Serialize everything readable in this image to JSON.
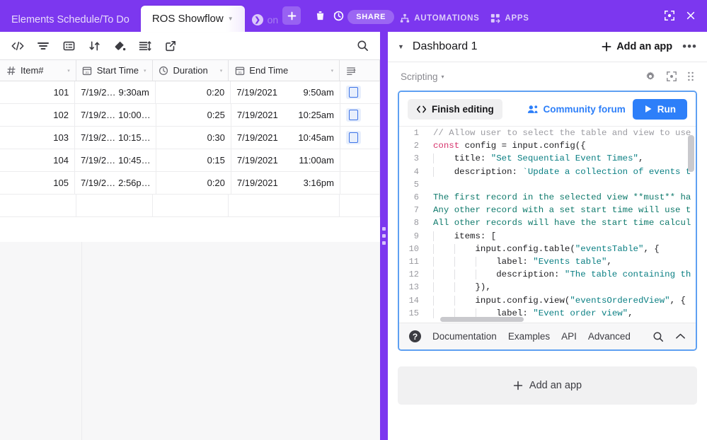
{
  "topbar": {
    "accent_color": "#7c37ef",
    "tabs": [
      {
        "label": "Elements Schedule/To Do",
        "active": false,
        "partial": false
      },
      {
        "label": "ROS Showflow",
        "active": true,
        "partial": false,
        "caret": "▼"
      },
      {
        "label": "on",
        "active": false,
        "partial": true,
        "icon": "chevron-right-circle-icon"
      }
    ],
    "add_tab_label": "+",
    "trash_icon": "trash-icon",
    "history_icon": "history-clock-icon",
    "share_label": "SHARE",
    "automations_label": "AUTOMATIONS",
    "apps_label": "APPS",
    "expand_icon": "expand-icon",
    "close_icon": "close-icon"
  },
  "grid_toolbar": {
    "icons": [
      {
        "name": "code-view-icon",
        "glyph": "</>"
      },
      {
        "name": "filter-icon",
        "glyph": "filter"
      },
      {
        "name": "group-icon",
        "glyph": "group"
      },
      {
        "name": "sort-icon",
        "glyph": "sort"
      },
      {
        "name": "color-fill-icon",
        "glyph": "paint"
      },
      {
        "name": "row-height-icon",
        "glyph": "rowheight"
      },
      {
        "name": "share-view-icon",
        "glyph": "external"
      }
    ],
    "search_icon": "search-icon"
  },
  "table": {
    "columns": [
      {
        "label": "Item#",
        "icon": "hash-icon",
        "caret": "▾"
      },
      {
        "label": "Start Time",
        "icon": "calendar-icon",
        "caret": "▾"
      },
      {
        "label": "Duration",
        "icon": "clock-icon",
        "caret": "▾"
      },
      {
        "label": "End Time",
        "icon": "calendar-icon",
        "caret": "▾"
      },
      {
        "label": "",
        "icon": "long-text-icon",
        "caret": ""
      }
    ],
    "rows": [
      {
        "item": "101",
        "start_date": "7/19/2…",
        "start_time": "9:30am",
        "duration": "0:20",
        "end_date": "7/19/2021",
        "end_time": "9:50am",
        "has_badge": true
      },
      {
        "item": "102",
        "start_date": "7/19/2…",
        "start_time": "10:00…",
        "duration": "0:25",
        "end_date": "7/19/2021",
        "end_time": "10:25am",
        "has_badge": true
      },
      {
        "item": "103",
        "start_date": "7/19/2…",
        "start_time": "10:15…",
        "duration": "0:30",
        "end_date": "7/19/2021",
        "end_time": "10:45am",
        "has_badge": true
      },
      {
        "item": "104",
        "start_date": "7/19/2…",
        "start_time": "10:45…",
        "duration": "0:15",
        "end_date": "7/19/2021",
        "end_time": "11:00am",
        "has_badge": false
      },
      {
        "item": "105",
        "start_date": "7/19/2…",
        "start_time": "2:56p…",
        "duration": "0:20",
        "end_date": "7/19/2021",
        "end_time": "3:16pm",
        "has_badge": false
      }
    ]
  },
  "divider": {
    "handle_icon": "drag-handle-icon"
  },
  "dashboard": {
    "caret": "▼",
    "title": "Dashboard 1",
    "add_app_label": "Add an app",
    "add_app_plus": "+",
    "more_dots": "•••",
    "app": {
      "name": "Scripting",
      "name_caret": "▾",
      "settings_icon": "gear-icon",
      "fullscreen_icon": "expand-app-icon",
      "drag_icon": "drag-dots-icon",
      "toolbar": {
        "finish_editing_label": "Finish editing",
        "code_icon": "code-brackets-icon",
        "community_forum_label": "Community forum",
        "people_icon": "people-icon",
        "run_label": "Run",
        "play_icon": "play-icon"
      },
      "code_lines": [
        {
          "n": "1",
          "tokens": [
            {
              "t": "com",
              "s": "// Allow user to select the table and view to use"
            }
          ],
          "indent": 0
        },
        {
          "n": "2",
          "tokens": [
            {
              "t": "kw",
              "s": "const"
            },
            {
              "t": "pln",
              "s": " config = input.config({"
            }
          ],
          "indent": 0
        },
        {
          "n": "3",
          "tokens": [
            {
              "t": "pln",
              "s": "    title: "
            },
            {
              "t": "str",
              "s": "\"Set Sequential Event Times\""
            },
            {
              "t": "pln",
              "s": ","
            }
          ],
          "indent": 1
        },
        {
          "n": "4",
          "tokens": [
            {
              "t": "pln",
              "s": "    description: "
            },
            {
              "t": "str",
              "s": "`Update a collection of events t"
            }
          ],
          "indent": 1
        },
        {
          "n": "5",
          "tokens": [
            {
              "t": "pln",
              "s": ""
            }
          ],
          "indent": 1
        },
        {
          "n": "6",
          "tokens": [
            {
              "t": "grn",
              "s": "The first record in the selected view **must** ha"
            }
          ],
          "indent": 0
        },
        {
          "n": "7",
          "tokens": [
            {
              "t": "grn",
              "s": "Any other record with a set start time will use t"
            }
          ],
          "indent": 0
        },
        {
          "n": "8",
          "tokens": [
            {
              "t": "grn",
              "s": "All other records will have the start time calcul"
            }
          ],
          "indent": 0
        },
        {
          "n": "9",
          "tokens": [
            {
              "t": "pln",
              "s": "    items: ["
            }
          ],
          "indent": 1
        },
        {
          "n": "10",
          "tokens": [
            {
              "t": "pln",
              "s": "        input.config.table("
            },
            {
              "t": "str",
              "s": "\"eventsTable\""
            },
            {
              "t": "pln",
              "s": ", {"
            }
          ],
          "indent": 2
        },
        {
          "n": "11",
          "tokens": [
            {
              "t": "pln",
              "s": "            label: "
            },
            {
              "t": "str",
              "s": "\"Events table\""
            },
            {
              "t": "pln",
              "s": ","
            }
          ],
          "indent": 3
        },
        {
          "n": "12",
          "tokens": [
            {
              "t": "pln",
              "s": "            description: "
            },
            {
              "t": "str",
              "s": "\"The table containing th"
            }
          ],
          "indent": 3
        },
        {
          "n": "13",
          "tokens": [
            {
              "t": "pln",
              "s": "        }),"
            }
          ],
          "indent": 2
        },
        {
          "n": "14",
          "tokens": [
            {
              "t": "pln",
              "s": "        input.config.view("
            },
            {
              "t": "str",
              "s": "\"eventsOrderedView\""
            },
            {
              "t": "pln",
              "s": ", {"
            }
          ],
          "indent": 2
        },
        {
          "n": "15",
          "tokens": [
            {
              "t": "pln",
              "s": "            label: "
            },
            {
              "t": "str",
              "s": "\"Event order view\""
            },
            {
              "t": "pln",
              "s": ","
            }
          ],
          "indent": 3
        }
      ],
      "footer": {
        "help_icon": "help-icon",
        "help_glyph": "?",
        "links": [
          "Documentation",
          "Examples",
          "API",
          "Advanced"
        ],
        "search_icon": "search-icon",
        "collapse_icon": "chevron-up-icon"
      }
    },
    "add_app_bottom": {
      "plus": "+",
      "label": "Add an app"
    }
  }
}
